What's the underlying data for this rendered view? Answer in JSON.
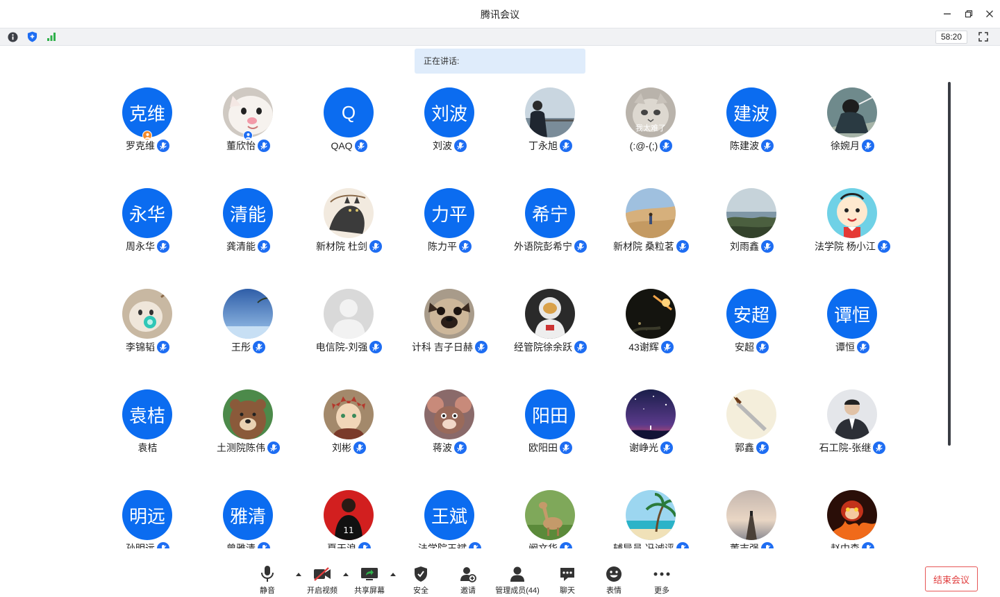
{
  "window": {
    "title": "腾讯会议"
  },
  "infobar": {
    "timer": "58:20"
  },
  "speaking_label": "正在讲话:",
  "participants": [
    {
      "name": "罗克维",
      "avatar_text": "克维",
      "host": true
    },
    {
      "name": "董欣怡",
      "avatar_image": "white-cat-photo",
      "cohost": true
    },
    {
      "name": "QAQ",
      "avatar_text": "Q"
    },
    {
      "name": "刘波",
      "avatar_text": "刘波"
    },
    {
      "name": "丁永旭",
      "avatar_image": "man-at-railing-photo"
    },
    {
      "name": "(:@-(;)",
      "avatar_image": "grumpy-cat-meme",
      "avatar_caption": "我太难了"
    },
    {
      "name": "陈建波",
      "avatar_text": "建波"
    },
    {
      "name": "徐婉月",
      "avatar_image": "anime-warrior-photo"
    },
    {
      "name": "周永华",
      "avatar_text": "永华"
    },
    {
      "name": "龚清能",
      "avatar_text": "清能"
    },
    {
      "name": "新材院 杜剑",
      "avatar_image": "cat-sketch-art"
    },
    {
      "name": "陈力平",
      "avatar_text": "力平"
    },
    {
      "name": "外语院彭希宁",
      "avatar_text": "希宁"
    },
    {
      "name": "新材院 桑粒茗",
      "avatar_image": "desert-person-photo"
    },
    {
      "name": "刘雨鑫",
      "avatar_image": "lake-landscape-photo"
    },
    {
      "name": "法学院 杨小江",
      "avatar_image": "cartoon-kid-avatar"
    },
    {
      "name": "李锦韬",
      "avatar_image": "cat-with-pacifier-photo"
    },
    {
      "name": "王彤",
      "avatar_image": "blue-sky-beach-photo"
    },
    {
      "name": "电信院-刘强",
      "avatar_image": "default-person-avatar"
    },
    {
      "name": "计科 吉子日赫",
      "avatar_image": "pug-dog-photo"
    },
    {
      "name": "经管院徐余跃",
      "avatar_image": "astronaut-photo"
    },
    {
      "name": "43谢辉",
      "avatar_image": "night-sparks-photo"
    },
    {
      "name": "安超",
      "avatar_text": "安超"
    },
    {
      "name": "谭恒",
      "avatar_text": "谭恒"
    },
    {
      "name": "袁桔",
      "avatar_text": "袁桔",
      "no_mic": true
    },
    {
      "name": "土测院陈伟",
      "avatar_image": "cartoon-bear-avatar"
    },
    {
      "name": "刘彬",
      "avatar_image": "anime-gaara-avatar"
    },
    {
      "name": "蒋波",
      "avatar_image": "cartoon-mouse-avatar"
    },
    {
      "name": "欧阳田",
      "avatar_text": "阳田"
    },
    {
      "name": "谢峥光",
      "avatar_image": "starry-night-art"
    },
    {
      "name": "郭鑫",
      "avatar_image": "dagger-drawing"
    },
    {
      "name": "石工院-张继",
      "avatar_image": "man-in-suit-photo"
    },
    {
      "name": "孙明远",
      "avatar_text": "明远"
    },
    {
      "name": "曾雅清",
      "avatar_text": "雅清"
    },
    {
      "name": "夏天浪",
      "avatar_image": "basketball-player-art"
    },
    {
      "name": "法学院王斌",
      "avatar_text": "王斌"
    },
    {
      "name": "阚文华",
      "avatar_image": "deer-photo"
    },
    {
      "name": "辅导员 冯诚评",
      "avatar_image": "palm-beach-photo"
    },
    {
      "name": "董志强",
      "avatar_image": "pier-sunset-photo"
    },
    {
      "name": "赵中森",
      "avatar_image": "fire-monkey-art"
    }
  ],
  "toolbar": {
    "items": [
      {
        "id": "mute",
        "label": "静音",
        "icon": "microphone-icon"
      },
      {
        "id": "video",
        "label": "开启视频",
        "icon": "video-off-icon"
      },
      {
        "id": "share",
        "label": "共享屏幕",
        "icon": "share-screen-icon"
      },
      {
        "id": "security",
        "label": "安全",
        "icon": "shield-icon"
      },
      {
        "id": "invite",
        "label": "邀请",
        "icon": "add-user-icon"
      },
      {
        "id": "members",
        "label": "管理成员(44)",
        "icon": "members-icon"
      },
      {
        "id": "chat",
        "label": "聊天",
        "icon": "chat-icon"
      },
      {
        "id": "reactions",
        "label": "表情",
        "icon": "smiley-icon"
      },
      {
        "id": "more",
        "label": "更多",
        "icon": "more-icon"
      }
    ],
    "end_label": "结束会议"
  },
  "colors": {
    "accent": "#0b6cf0",
    "mic": "#1e6df2",
    "end": "#e03d3d",
    "speaking_bg": "#dfecfb"
  }
}
